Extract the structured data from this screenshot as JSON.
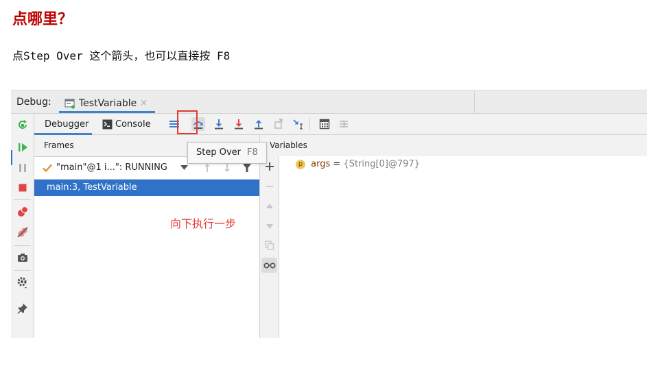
{
  "heading": "点哪里？",
  "instruction": "点Step Over 这个箭头，也可以直接按 F8",
  "debug_window": {
    "label": "Debug:",
    "tab_name": "TestVariable",
    "tab_close": "×"
  },
  "toolbar": {
    "debugger_tab": "Debugger",
    "console_tab": "Console"
  },
  "tooltip": {
    "title": "Step Over",
    "shortcut": "F8"
  },
  "frames": {
    "header": "Frames",
    "thread_label": "\"main\"@1 i...\": RUNNING",
    "selected_frame": "main:3, TestVariable"
  },
  "variables": {
    "header": "Variables",
    "var_badge": "p",
    "var_name": "args",
    "var_eq": " = ",
    "var_value": "{String[0]@797}"
  },
  "annotation": "向下执行一步",
  "colors": {
    "accent_blue": "#2f72c7",
    "tab_underline": "#4083c9",
    "highlight_red": "#e53935",
    "heading_red": "#c00000",
    "resume_green": "#3fb34f",
    "stop_red": "#e04545",
    "arrow_blue": "#3a7dd0"
  },
  "icons": [
    "rerun-icon",
    "resume-icon",
    "pause-icon",
    "stop-icon",
    "view-breakpoints-icon",
    "mute-breakpoints-icon",
    "camera-icon",
    "settings-icon",
    "pin-icon",
    "console-icon",
    "menu-icon",
    "step-over-icon",
    "step-into-icon",
    "force-step-into-icon",
    "step-out-icon",
    "drop-frame-icon",
    "run-to-cursor-icon",
    "evaluate-expression-icon",
    "trace-icon",
    "check-icon",
    "dropdown-icon",
    "up-arrow-icon",
    "down-arrow-icon",
    "filter-icon",
    "add-icon",
    "remove-icon",
    "move-up-icon",
    "move-down-icon",
    "copy-icon",
    "watches-glasses-icon"
  ]
}
